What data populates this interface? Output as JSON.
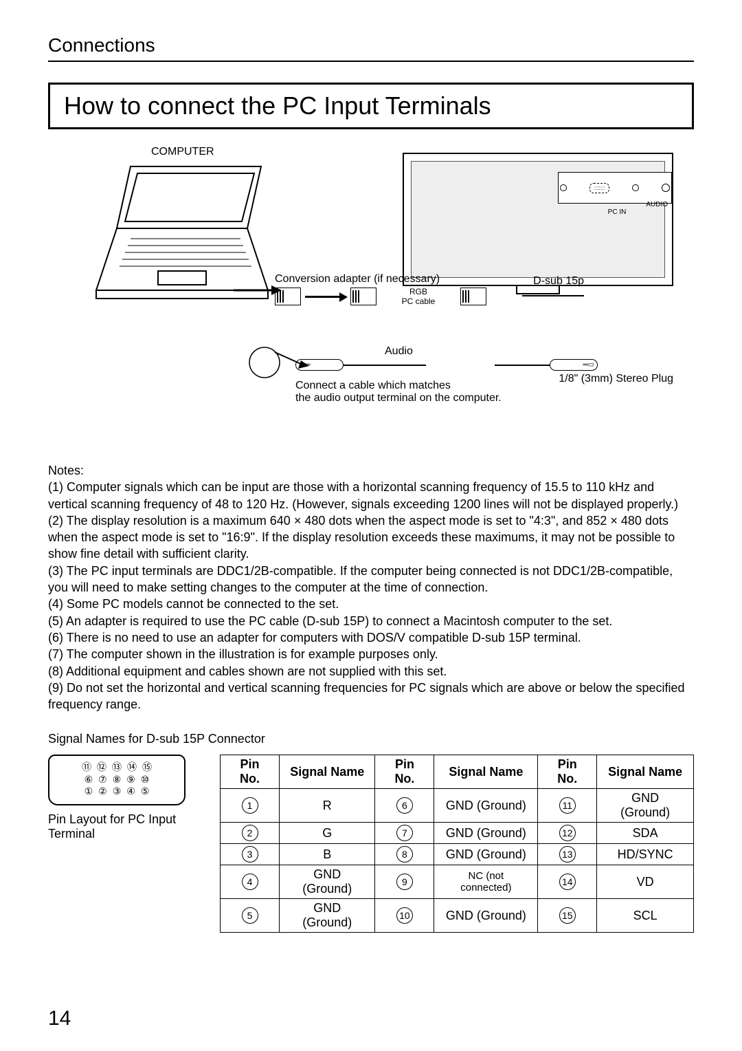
{
  "header": {
    "section": "Connections",
    "title": "How to connect the PC Input Terminals",
    "page_number": "14"
  },
  "diagram": {
    "computer_label": "COMPUTER",
    "conversion_adapter": "Conversion adapter (if necessary)",
    "dsub": "D-sub 15p",
    "rgb": "RGB",
    "pc_cable": "PC cable",
    "audio": "Audio",
    "audio_note": "Connect a cable which matches\nthe audio output terminal on the computer.",
    "stereo_plug": "1/8\" (3mm) Stereo Plug",
    "port_audio": "AUDIO",
    "port_pcin": "PC IN"
  },
  "notes": {
    "heading": "Notes:",
    "items": [
      "(1) Computer signals which can be input are those with a horizontal scanning frequency of 15.5 to 110 kHz and vertical scanning frequency of 48 to 120 Hz. (However, signals exceeding 1200 lines will not be displayed properly.)",
      "(2) The display resolution is a maximum 640 × 480 dots when the aspect mode is set to \"4:3\", and 852 × 480 dots when the aspect mode is set to \"16:9\". If the display resolution exceeds these maximums, it may not be possible to show fine detail with sufficient clarity.",
      "(3) The PC input terminals are DDC1/2B-compatible. If the computer being connected is not DDC1/2B-compatible, you will need to make setting changes to the computer at the time of connection.",
      "(4) Some PC models cannot be connected to the set.",
      "(5) An adapter is required to use the PC cable (D-sub 15P) to connect a Macintosh computer to the set.",
      "(6) There is no need to use an adapter for computers with DOS/V compatible D-sub 15P terminal.",
      "(7) The computer shown in the illustration is for example purposes only.",
      "(8) Additional equipment and cables shown are not supplied with this set.",
      "(9) Do not set the horizontal and vertical scanning frequencies for PC signals which are above or below the specified frequency range."
    ]
  },
  "pin_section": {
    "signal_names_title": "Signal Names for D-sub 15P Connector",
    "layout_caption": "Pin Layout for PC Input Terminal",
    "headers": [
      "Pin No.",
      "Signal Name",
      "Pin No.",
      "Signal Name",
      "Pin No.",
      "Signal Name"
    ],
    "rows": [
      [
        "1",
        "R",
        "6",
        "GND (Ground)",
        "11",
        "GND (Ground)"
      ],
      [
        "2",
        "G",
        "7",
        "GND (Ground)",
        "12",
        "SDA"
      ],
      [
        "3",
        "B",
        "8",
        "GND (Ground)",
        "13",
        "HD/SYNC"
      ],
      [
        "4",
        "GND (Ground)",
        "9",
        "NC (not connected)",
        "14",
        "VD"
      ],
      [
        "5",
        "GND (Ground)",
        "10",
        "GND (Ground)",
        "15",
        "SCL"
      ]
    ],
    "trap_rows": [
      [
        "⑪",
        "⑫",
        "⑬",
        "⑭",
        "⑮"
      ],
      [
        "⑥",
        "⑦",
        "⑧",
        "⑨",
        "⑩"
      ],
      [
        "①",
        "②",
        "③",
        "④",
        "⑤"
      ]
    ]
  }
}
